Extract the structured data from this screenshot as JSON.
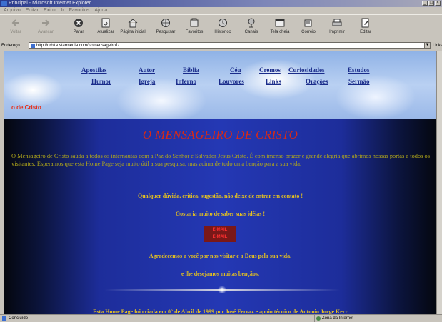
{
  "window": {
    "title": "Principal - Microsoft Internet Explorer"
  },
  "menu": {
    "items": [
      "Arquivo",
      "Editar",
      "Exibir",
      "Ir",
      "Favoritos",
      "Ajuda"
    ]
  },
  "toolbar": {
    "back": "Voltar",
    "forward": "Avançar",
    "stop": "Parar",
    "refresh": "Atualizar",
    "home": "Página inicial",
    "search": "Pesquisar",
    "favorites": "Favoritos",
    "history": "Histórico",
    "channels": "Canais",
    "fullscreen": "Tela cheia",
    "mail": "Correio",
    "print": "Imprimir",
    "edit": "Editar"
  },
  "address": {
    "label": "Endereço",
    "url": "http://orbita.starmedia.com/~omensageiro1/",
    "links": "Links"
  },
  "nav": {
    "row1": [
      "Apostilas",
      "Autor",
      "Bíblia",
      "Céu",
      "Cremos",
      "Curiosidades",
      "Estudos"
    ],
    "row2": [
      "Humor",
      "Igreja",
      "Inferno",
      "Louvores",
      "Links",
      "Orações",
      "Sermão"
    ],
    "banner_text": "o de Cristo"
  },
  "content": {
    "title": "O MENSAGEIRO DE CRISTO",
    "intro": "O Mensageiro de Cristo saúda a todos os internautas com a Paz do Senhor e Salvador Jesus Cristo. É com imenso prazer e grande alegria que abrimos nossas portas a todos os visitantes. Esperamos que esta Home Page seja muito útil a sua pesquisa, mas acima de tudo uma benção para a sua vida.",
    "contact": "Qualquer dúvida, crítica, sugestão, não deixe de entrar em contato !",
    "ideas": "Gostaria muito de saber suas idéias !",
    "email_label": "E-MAIL",
    "thanks": "Agradecemos a você por nos visitar e a Deus pela sua vida.",
    "blessing": "e lhe desejamos muitas bençãos.",
    "footer": "Esta Home Page foi criada em 0° de Abril de 1999 por José Ferraz e apoio técnico de Antonio Jorge Kerr"
  },
  "status": {
    "text": "Concluído",
    "zone": "Zona da Internet"
  },
  "colors": {
    "title": "#d62a18",
    "nav": "#1a2c8a",
    "text_gold": "#e4c020",
    "content_bg": "#2438b4"
  }
}
